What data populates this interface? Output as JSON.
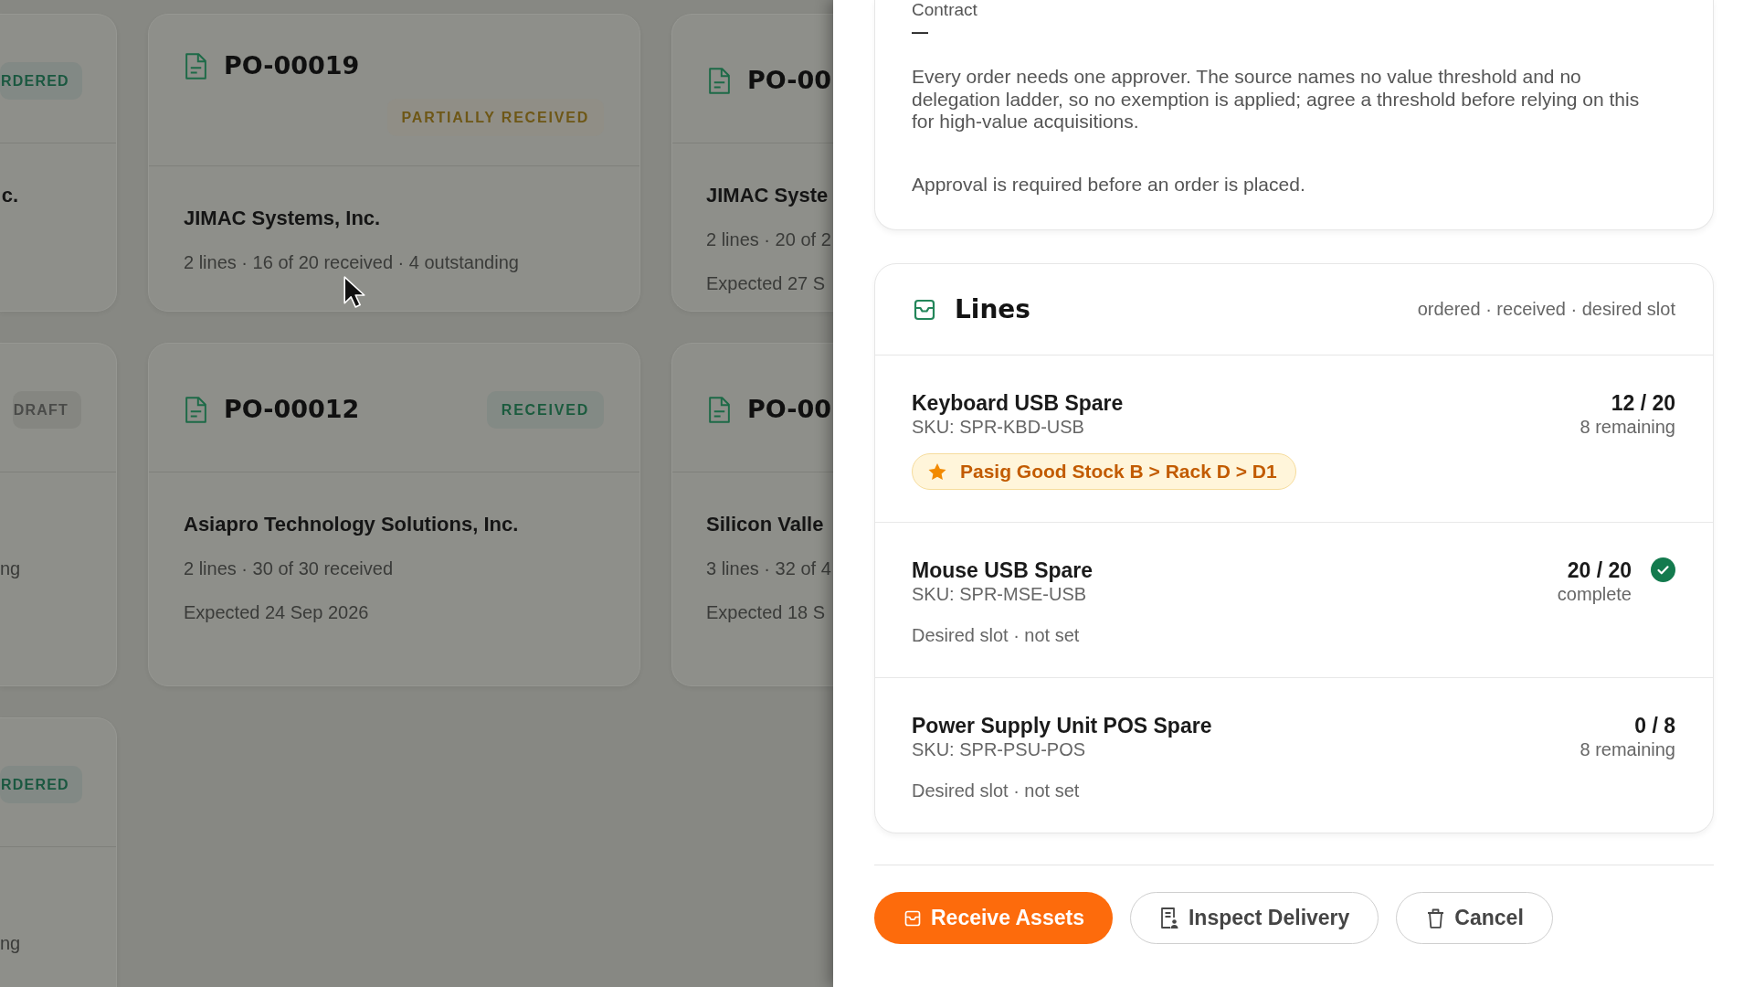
{
  "board": {
    "cards": [
      {
        "badge": {
          "label": "RDERED",
          "kind": "ordered"
        },
        "supplier": "c."
      },
      {
        "title": "PO-00019",
        "badge": {
          "label": "PARTIALLY RECEIVED",
          "kind": "partial"
        },
        "supplier": "JIMAC Systems, Inc.",
        "details": [
          "2 lines · 16 of 20 received · 4 outstanding"
        ]
      },
      {
        "title": "PO-00",
        "supplier": "JIMAC Syste",
        "details": [
          "2 lines · 20 of 2",
          "Expected 27 S"
        ]
      },
      {
        "badge": {
          "label": "DRAFT",
          "kind": "draft"
        },
        "details": [
          "ng"
        ]
      },
      {
        "title": "PO-00012",
        "badge": {
          "label": "RECEIVED",
          "kind": "received"
        },
        "supplier": "Asiapro Technology Solutions, Inc.",
        "details": [
          "2 lines · 30 of 30 received",
          "Expected 24 Sep 2026"
        ]
      },
      {
        "title": "PO-00",
        "supplier": "Silicon Valle",
        "details": [
          "3 lines · 32 of 4",
          "Expected 18 S"
        ]
      },
      {
        "badge": {
          "label": "RDERED",
          "kind": "ordered"
        },
        "details": [
          "ng"
        ]
      }
    ]
  },
  "drawer": {
    "terms_card": {
      "label": "Contract",
      "value": "—",
      "notes": [
        "Every order needs one approver. The source names no value threshold and no delegation ladder, so no exemption is applied; agree a threshold before relying on this for high-value acquisitions.",
        "Approval is required before an order is placed."
      ]
    },
    "lines_card": {
      "title": "Lines",
      "legend": "ordered · received · desired slot",
      "items": [
        {
          "name": "Keyboard USB Spare",
          "sku": "SKU: SPR-KBD-USB",
          "quantity": "12 / 20",
          "status": "8 remaining",
          "complete": false,
          "slot": {
            "kind": "chip",
            "label": "Pasig Good Stock B > Rack D > D1"
          }
        },
        {
          "name": "Mouse USB Spare",
          "sku": "SKU: SPR-MSE-USB",
          "quantity": "20 / 20",
          "status": "complete",
          "complete": true,
          "slot": {
            "kind": "text",
            "label": "Desired slot · not set"
          }
        },
        {
          "name": "Power Supply Unit POS Spare",
          "sku": "SKU: SPR-PSU-POS",
          "quantity": "0 / 8",
          "status": "8 remaining",
          "complete": false,
          "slot": {
            "kind": "text",
            "label": "Desired slot · not set"
          }
        }
      ]
    },
    "actions": [
      {
        "label": "Receive Assets",
        "kind": "primary"
      },
      {
        "label": "Inspect Delivery",
        "kind": "secondary"
      },
      {
        "label": "Cancel",
        "kind": "secondary"
      }
    ]
  }
}
